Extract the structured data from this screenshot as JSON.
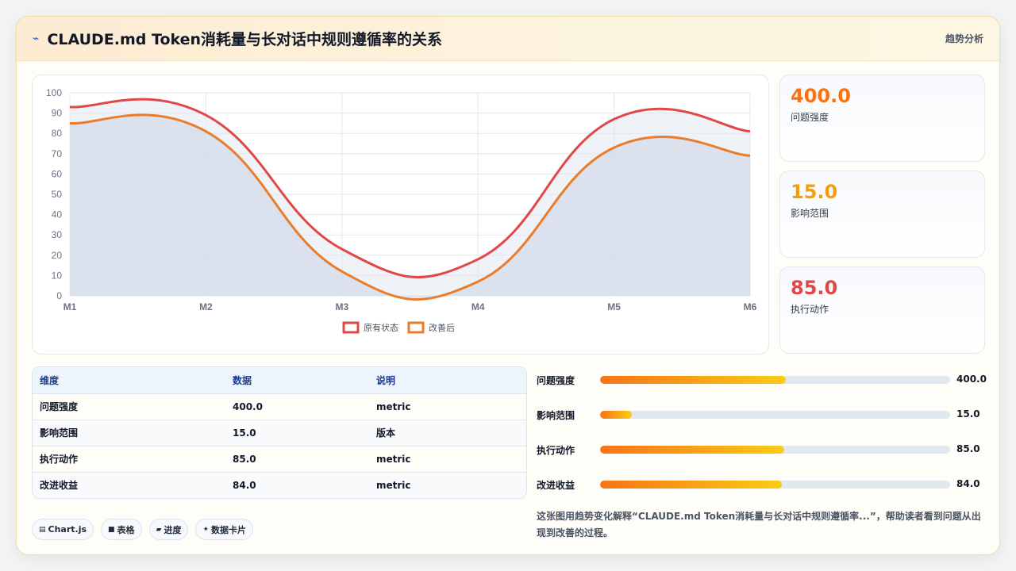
{
  "header": {
    "title": "CLAUDE.md Token消耗量与长对话中规则遵循率的关系",
    "tag": "趋势分析"
  },
  "stats": [
    {
      "value": "400.0",
      "label": "问题强度",
      "color": "#f97316"
    },
    {
      "value": "15.0",
      "label": "影响范围",
      "color": "#f59e0b"
    },
    {
      "value": "85.0",
      "label": "执行动作",
      "color": "#e04848"
    }
  ],
  "table": {
    "headers": [
      "维度",
      "数据",
      "说明"
    ],
    "rows": [
      [
        "问题强度",
        "400.0",
        "metric"
      ],
      [
        "影响范围",
        "15.0",
        "版本"
      ],
      [
        "执行动作",
        "85.0",
        "metric"
      ],
      [
        "改进收益",
        "84.0",
        "metric"
      ]
    ]
  },
  "bars": [
    {
      "label": "问题强度",
      "value": "400.0",
      "fraction": 0.53
    },
    {
      "label": "影响范围",
      "value": "15.0",
      "fraction": 0.09
    },
    {
      "label": "执行动作",
      "value": "85.0",
      "fraction": 0.525
    },
    {
      "label": "改进收益",
      "value": "84.0",
      "fraction": 0.52
    }
  ],
  "chips": [
    {
      "icon": "chart-icon",
      "glyph": "▤",
      "label": "Chart.js"
    },
    {
      "icon": "table-icon",
      "glyph": "■",
      "label": "表格"
    },
    {
      "icon": "progress-icon",
      "glyph": "▰",
      "label": "进度"
    },
    {
      "icon": "sparkle-icon",
      "glyph": "✦",
      "label": "数据卡片"
    }
  ],
  "description": "这张图用趋势变化解释“CLAUDE.md Token消耗量与长对话中规则遵循率...”，帮助读者看到问题从出现到改善的过程。",
  "chart_data": {
    "type": "line",
    "categories": [
      "M1",
      "M2",
      "M3",
      "M4",
      "M5",
      "M6"
    ],
    "series": [
      {
        "name": "原有状态",
        "values": [
          93,
          89,
          23,
          18,
          87,
          81
        ],
        "color": "#e04848"
      },
      {
        "name": "改善后",
        "values": [
          85,
          81,
          12,
          7,
          73,
          69
        ],
        "color": "#ea7d2c"
      }
    ],
    "ylim": [
      0,
      100
    ],
    "yticks": [
      0,
      10,
      20,
      30,
      40,
      50,
      60,
      70,
      80,
      90,
      100
    ],
    "grid": true,
    "legend": "bottom"
  }
}
